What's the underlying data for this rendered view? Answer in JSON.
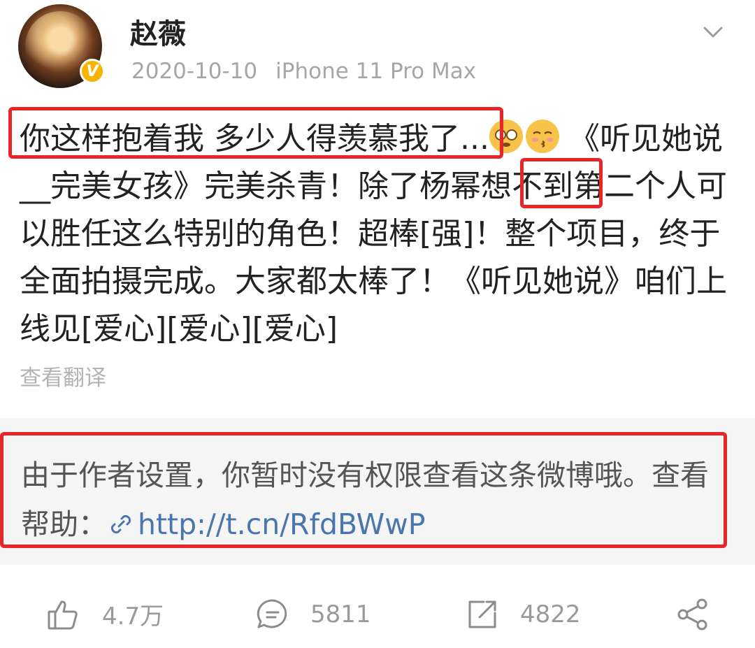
{
  "user": {
    "name": "赵薇",
    "verified_badge": "V",
    "date": "2020-10-10",
    "device": "iPhone 11 Pro Max"
  },
  "post": {
    "highlight_1": "你这样抱着我 多少人得羡慕我了",
    "ellipsis": "...",
    "part_2": " 《听见她说__完美女孩》完美杀青！除了",
    "highlight_2": "杨幂",
    "part_3": "想不到第二个人可以胜任这么特别的角色！超棒[强]！整个项目，终于全面拍摄完成。大家都太棒了！《听见她说》咱们上线见[爱心][爱心][爱心]",
    "translate_label": "查看翻译"
  },
  "notice": {
    "text": "由于作者设置，你暂时没有权限查看这条微博哦。查看帮助：",
    "link": "http://t.cn/RfdBWwP"
  },
  "actions": {
    "likes": "4.7万",
    "comments": "5811",
    "reposts": "4822"
  },
  "colors": {
    "highlight_box": "#e8262a",
    "link": "#4876ad",
    "verified": "#f7b500"
  },
  "icons": [
    "chevron-down-icon",
    "emoji-peek-icon",
    "emoji-kiss-icon",
    "link-icon",
    "like-icon",
    "comment-icon",
    "repost-icon",
    "share-icon"
  ]
}
